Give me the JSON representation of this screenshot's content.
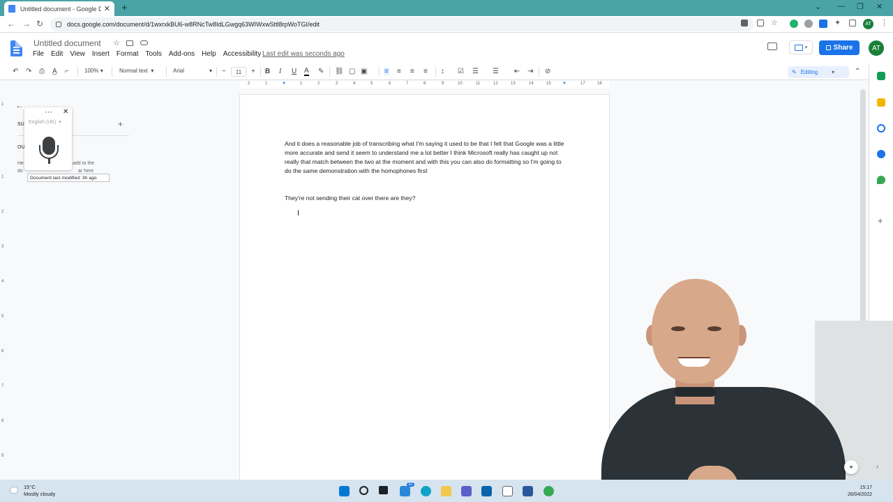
{
  "browser": {
    "tab_title": "Untitled document - Google Docs",
    "url": "docs.google.com/document/d/1wxrxkBU6-w8RNcTw8IdLGwgq63WIWxwSttl8rpWoTGI/edit"
  },
  "docs": {
    "title": "Untitled document",
    "menu": [
      "File",
      "Edit",
      "View",
      "Insert",
      "Format",
      "Tools",
      "Add-ons",
      "Help",
      "Accessibility"
    ],
    "last_edit": "Last edit was seconds ago",
    "share_label": "Share",
    "user_initials": "AT"
  },
  "toolbar": {
    "zoom": "100%",
    "style": "Normal text",
    "font": "Arial",
    "font_size": "11",
    "bold": "B",
    "italic": "I",
    "underline": "U",
    "mode": "Editing"
  },
  "ruler": {
    "marks": [
      "2",
      "1",
      "1",
      "2",
      "3",
      "4",
      "5",
      "6",
      "7",
      "8",
      "9",
      "10",
      "11",
      "12",
      "13",
      "14",
      "15",
      "16",
      "17",
      "18"
    ]
  },
  "document": {
    "paragraph1": "And it does a reasonable job of transcribing what I'm saying it used to be that I felt that Google was a little more accurate and send it seem to understand me a lot better I think Microsoft really has caught up not really that match between the two at the moment and with this you can also do formatting so I'm going to do the same demonstration with the homophones first",
    "paragraph2": "They're not sending their cat over there are they?"
  },
  "voice_typing": {
    "language": "English (UK)",
    "tooltip": "Document last modified: 3h ago"
  },
  "outline": {
    "summary_label": "SU",
    "outline_label": "OU",
    "hint_left": "He",
    "hint_left2": "do",
    "hint_right": "add to the",
    "hint_right2": "ar here"
  },
  "taskbar": {
    "temperature": "15°C",
    "weather": "Mostly cloudy",
    "time": "15:17",
    "date": "26/04/2022",
    "badge": "32"
  },
  "colors": {
    "tab_strip": "#4aa3a7",
    "accent": "#1a73e8",
    "avatar": "#188038"
  }
}
